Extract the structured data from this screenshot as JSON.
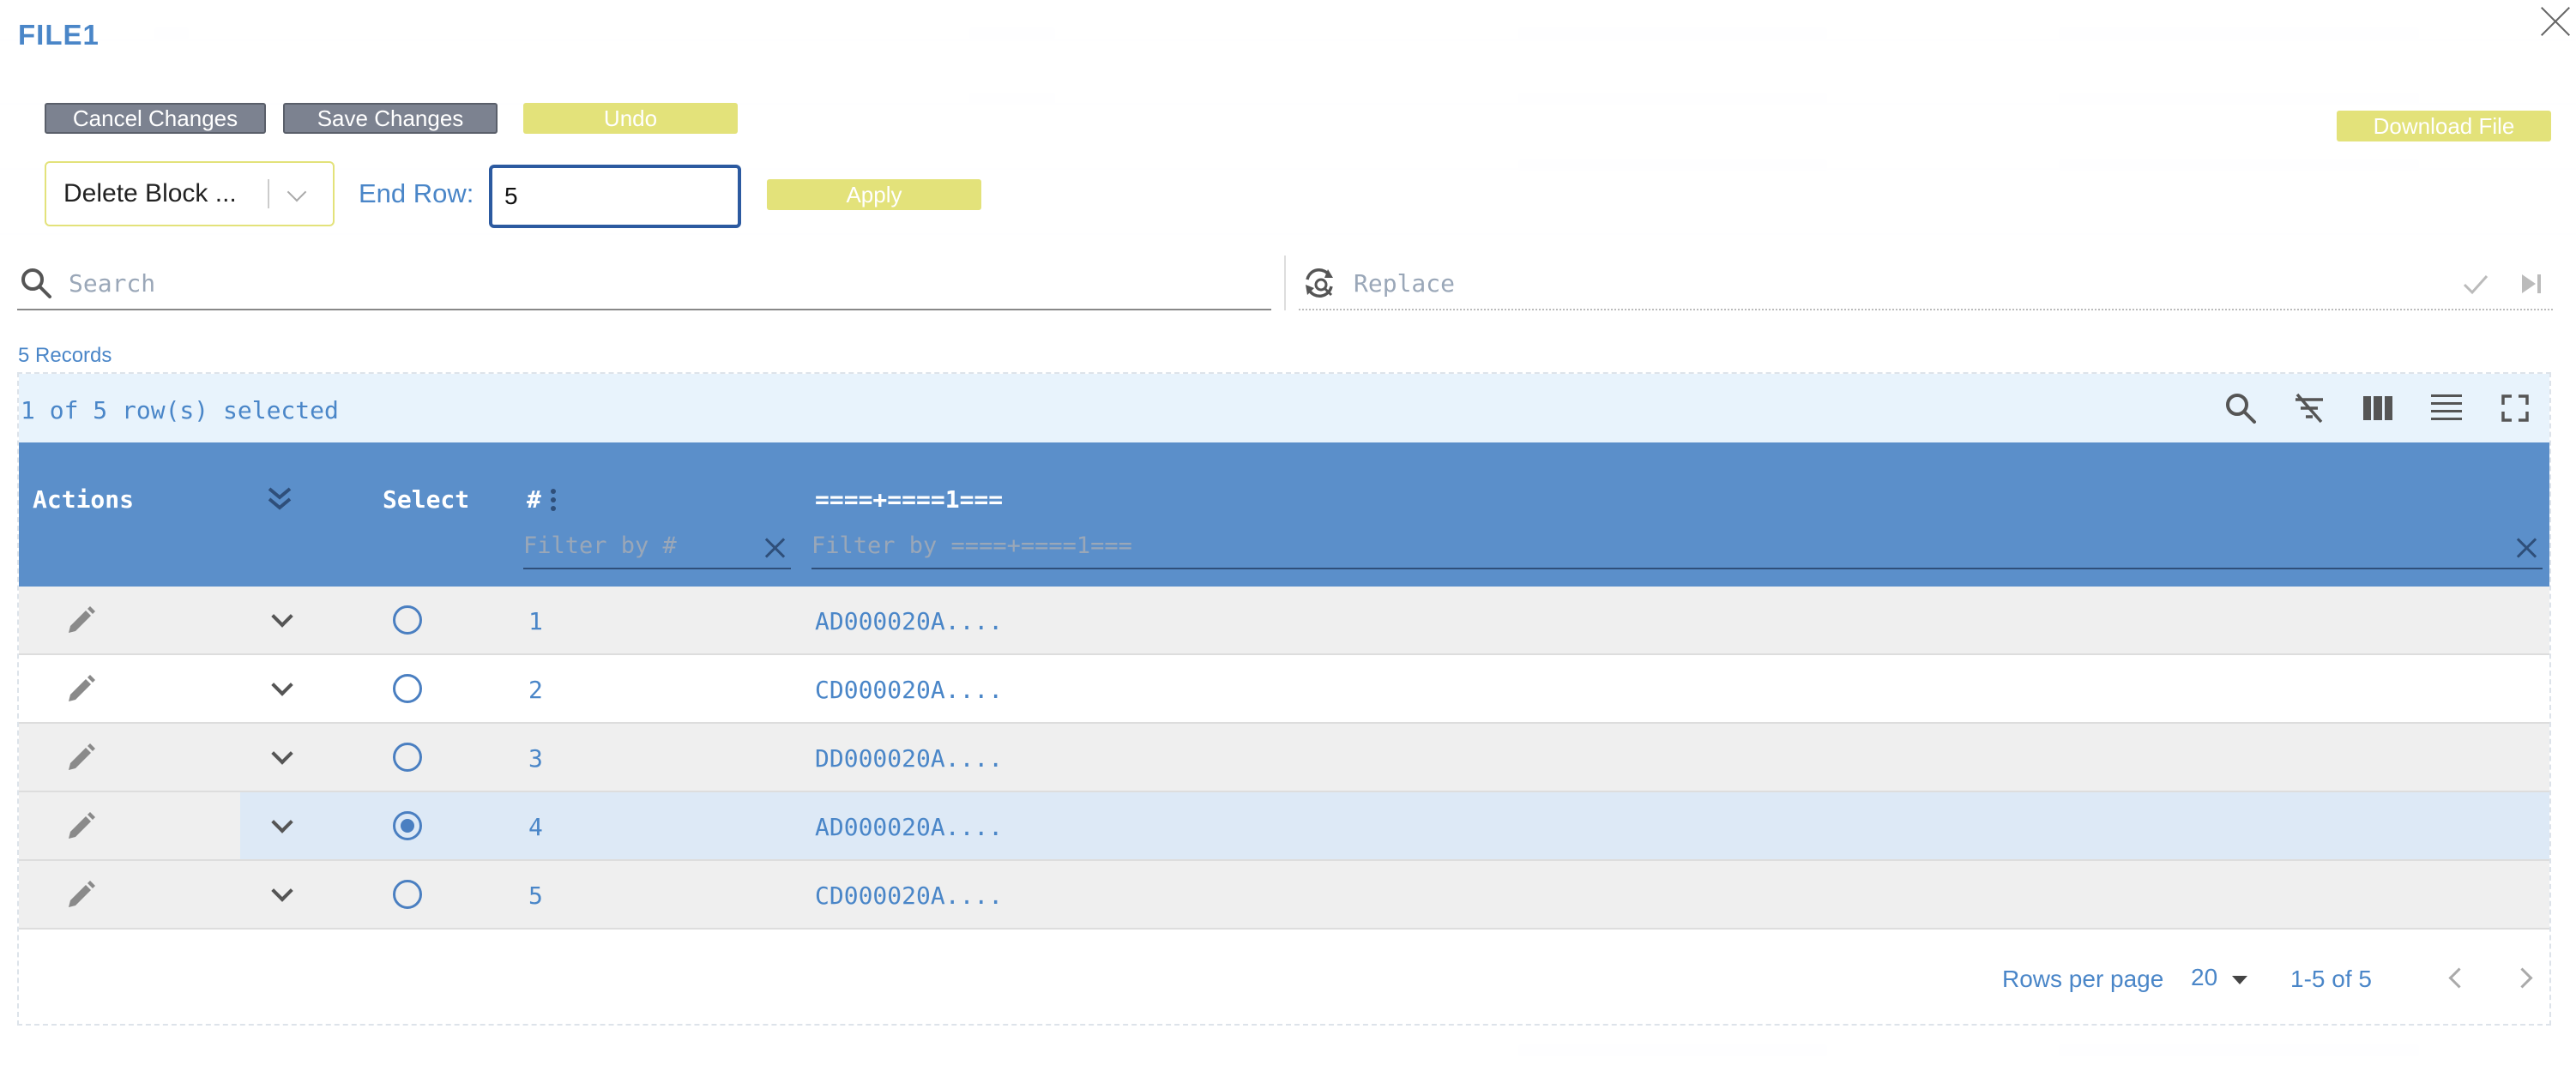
{
  "modal": {
    "title": "FILE1"
  },
  "toolbar": {
    "cancel_label": "Cancel Changes",
    "save_label": "Save Changes",
    "undo_label": "Undo",
    "download_label": "Download File",
    "apply_label": "Apply"
  },
  "operation": {
    "selected": "Delete Block ...",
    "end_row_label": "End Row:",
    "end_row_value": "5"
  },
  "search": {
    "placeholder": "Search",
    "replace_placeholder": "Replace"
  },
  "records_label": "5 Records",
  "table": {
    "selection_text": "1 of 5 row(s) selected",
    "columns": {
      "actions": "Actions",
      "select": "Select",
      "number": "#",
      "data": "====+====1==="
    },
    "filters": {
      "number_placeholder": "Filter by #",
      "data_placeholder": "Filter by ====+====1==="
    },
    "rows": [
      {
        "number": "1",
        "data": "AD000020A....",
        "selected": false
      },
      {
        "number": "2",
        "data": "CD000020A....",
        "selected": false
      },
      {
        "number": "3",
        "data": "DD000020A....",
        "selected": false
      },
      {
        "number": "4",
        "data": "AD000020A....",
        "selected": true
      },
      {
        "number": "5",
        "data": "CD000020A....",
        "selected": false
      }
    ],
    "pagination": {
      "rows_per_page_label": "Rows per page",
      "rows_per_page_value": "20",
      "range": "1-5 of 5"
    }
  },
  "colors": {
    "accent": "#4a86c8",
    "header_bg": "#5b8fca",
    "yellow_button": "#e3e27a",
    "gray_button": "#7c8290",
    "selected_row": "#dde9f6"
  },
  "icons": [
    "close-icon",
    "search-icon",
    "replace-icon",
    "check-icon",
    "skip-icon",
    "toolbar-search-icon",
    "clear-filter-icon",
    "columns-icon",
    "density-icon",
    "fullscreen-icon",
    "expand-all-icon",
    "column-menu-icon",
    "edit-icon",
    "expand-row-icon"
  ]
}
